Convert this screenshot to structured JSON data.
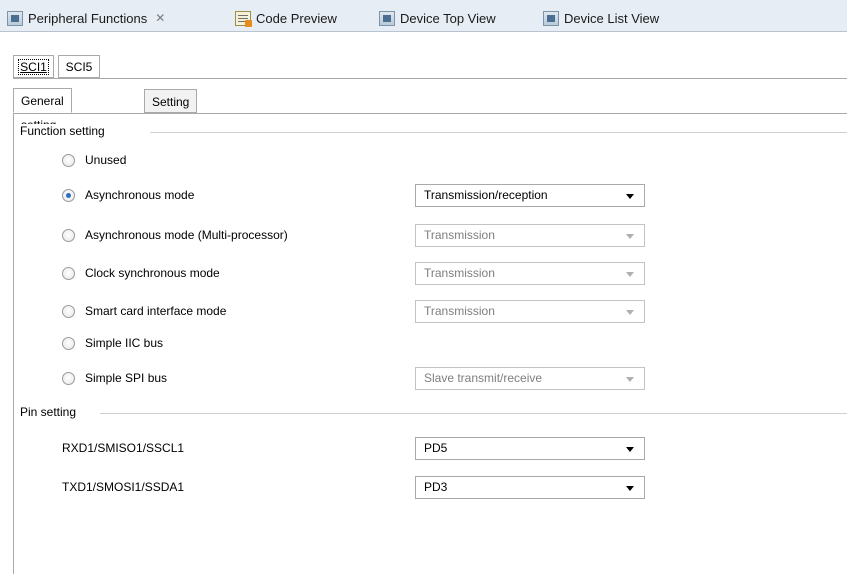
{
  "editor_tabs": [
    {
      "label": "Peripheral Functions",
      "icon": "chip-icon",
      "closable": true
    },
    {
      "label": "Code Preview",
      "icon": "code-preview-icon"
    },
    {
      "label": "Device Top View",
      "icon": "chip-icon"
    },
    {
      "label": "Device List View",
      "icon": "chip-icon"
    }
  ],
  "close_glyph": "✕",
  "channel_tabs": [
    "SCI1",
    "SCI5"
  ],
  "setting_tabs": [
    "General setting",
    "Setting"
  ],
  "function_setting": {
    "title": "Function setting",
    "modes": [
      {
        "label": "Unused",
        "checked": false
      },
      {
        "label": "Asynchronous mode",
        "checked": true,
        "select": "Transmission/reception",
        "enabled": true
      },
      {
        "label": "Asynchronous mode (Multi-processor)",
        "checked": false,
        "select": "Transmission",
        "enabled": false
      },
      {
        "label": "Clock synchronous mode",
        "checked": false,
        "select": "Transmission",
        "enabled": false
      },
      {
        "label": "Smart card interface mode",
        "checked": false,
        "select": "Transmission",
        "enabled": false
      },
      {
        "label": "Simple IIC bus",
        "checked": false
      },
      {
        "label": "Simple SPI bus",
        "checked": false,
        "select": "Slave transmit/receive",
        "enabled": false
      }
    ]
  },
  "pin_setting": {
    "title": "Pin setting",
    "pins": [
      {
        "label": "RXD1/SMISO1/SSCL1",
        "value": "PD5"
      },
      {
        "label": "TXD1/SMOSI1/SSDA1",
        "value": "PD3"
      }
    ]
  },
  "colors": {
    "tab_bar_bg": "#e7edf4",
    "radio_selected": "#2e6fc4",
    "disabled_text": "#7e7e7e"
  }
}
